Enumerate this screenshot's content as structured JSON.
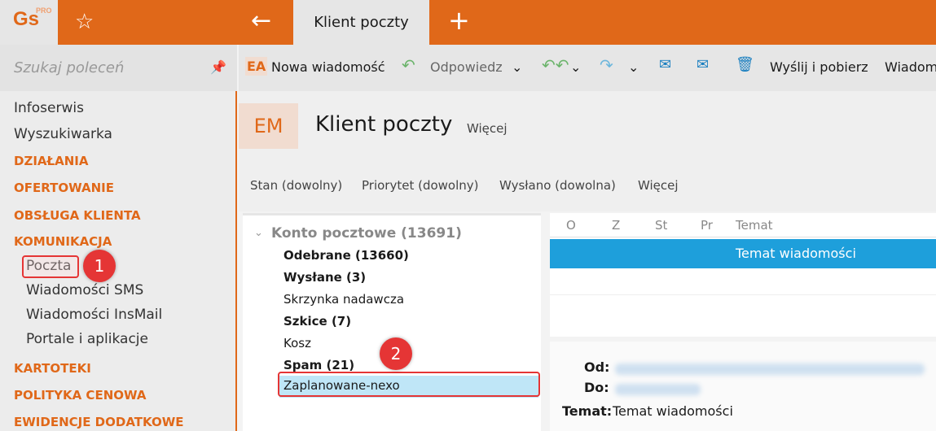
{
  "app": {
    "logo": "Gs",
    "logo_badge": "PRO",
    "tab_title": "Klient poczty"
  },
  "sidebar": {
    "search_placeholder": "Szukaj poleceń",
    "items": [
      {
        "label": "Infoserwis",
        "type": "item"
      },
      {
        "label": "Wyszukiwarka",
        "type": "item"
      },
      {
        "label": "DZIAŁANIA",
        "type": "category"
      },
      {
        "label": "OFERTOWANIE",
        "type": "category"
      },
      {
        "label": "OBSŁUGA KLIENTA",
        "type": "category"
      },
      {
        "label": "KOMUNIKACJA",
        "type": "category"
      },
      {
        "label": "Poczta",
        "type": "sub"
      },
      {
        "label": "Wiadomości SMS",
        "type": "sub"
      },
      {
        "label": "Wiadomości InsMail",
        "type": "sub"
      },
      {
        "label": "Portale i aplikacje",
        "type": "sub"
      },
      {
        "label": "KARTOTEKI",
        "type": "category"
      },
      {
        "label": "POLITYKA CENOWA",
        "type": "category"
      },
      {
        "label": "EWIDENCJE DODATKOWE",
        "type": "category"
      }
    ]
  },
  "toolbar": {
    "new_icon": "EA",
    "new_message": "Nowa wiadomość",
    "reply": "Odpowiedz",
    "send_receive": "Wyślij i pobierz",
    "messages": "Wiadom"
  },
  "header": {
    "icon": "EM",
    "title": "Klient poczty",
    "more": "Więcej"
  },
  "filters": [
    "Stan (dowolny)",
    "Priorytet (dowolny)",
    "Wysłano (dowolna)",
    "Więcej"
  ],
  "tree": {
    "account": "Konto pocztowe (13691)",
    "folders": [
      {
        "label": "Odebrane (13660)",
        "bold": true
      },
      {
        "label": "Wysłane (3)",
        "bold": true
      },
      {
        "label": "Skrzynka nadawcza",
        "bold": false
      },
      {
        "label": "Szkice (7)",
        "bold": true
      },
      {
        "label": "Kosz",
        "bold": false
      },
      {
        "label": "Spam (21)",
        "bold": true
      },
      {
        "label": "Zaplanowane-nexo",
        "bold": false
      }
    ]
  },
  "list": {
    "columns": [
      "O",
      "Z",
      "St",
      "Pr",
      "Temat"
    ],
    "rows": [
      {
        "subject": "Temat wiadomości"
      }
    ]
  },
  "preview": {
    "from_label": "Od:",
    "to_label": "Do:",
    "subject_label": "Temat:",
    "subject": "Temat wiadomości"
  },
  "annotations": {
    "step1": "1",
    "step2": "2"
  },
  "colors": {
    "accent": "#e06819",
    "selection": "#1e9fdb",
    "annotation": "#e53535"
  }
}
